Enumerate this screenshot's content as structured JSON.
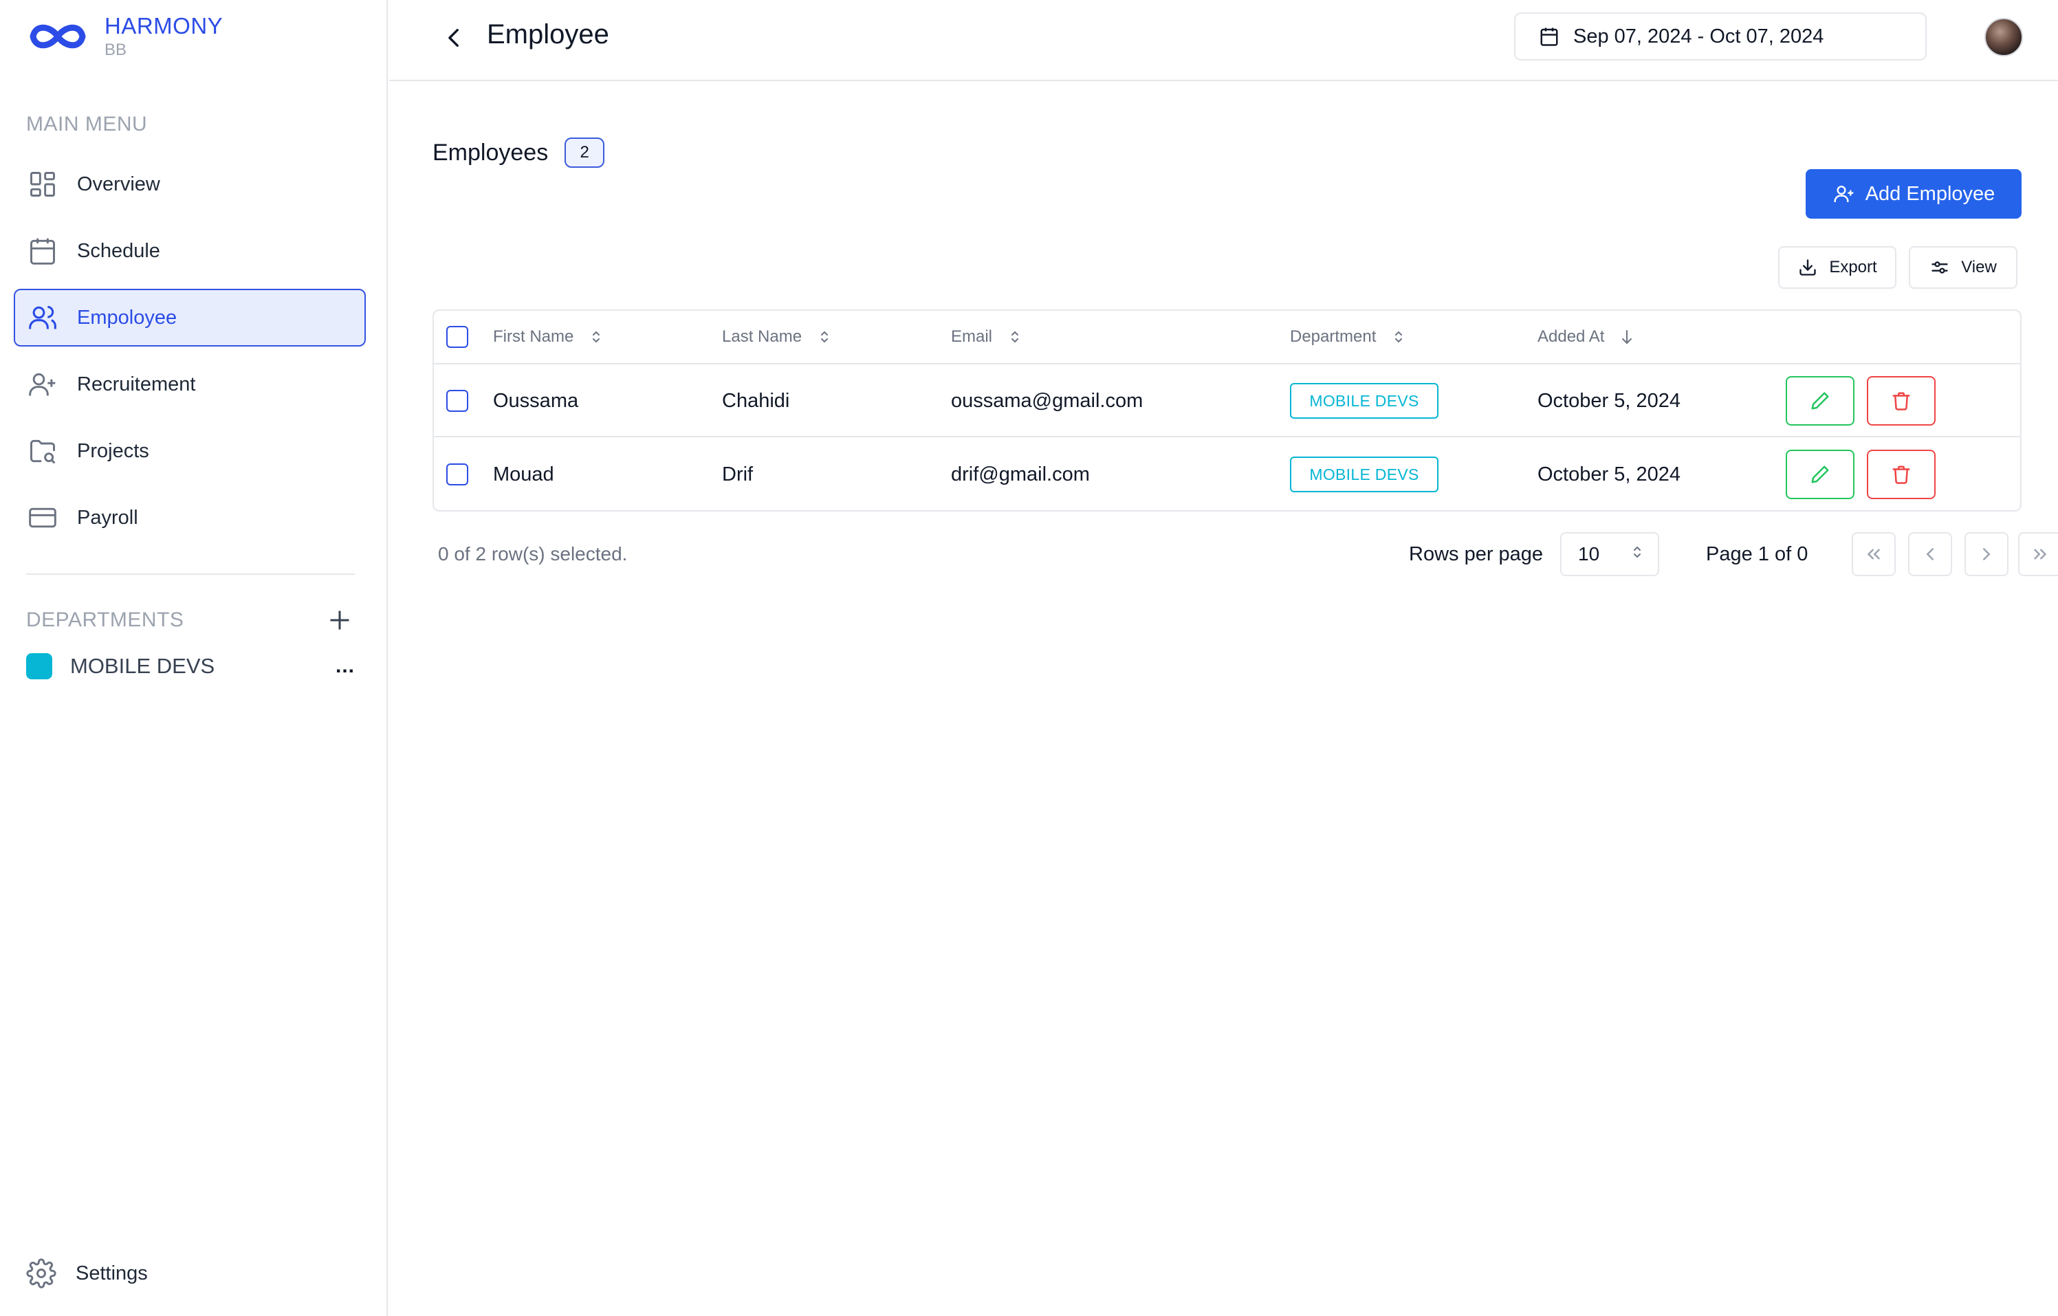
{
  "brand": {
    "name": "HARMONY",
    "subtitle": "BB"
  },
  "sidebar": {
    "main_menu_title": "MAIN MENU",
    "items": [
      {
        "label": "Overview",
        "icon": "grid-icon"
      },
      {
        "label": "Schedule",
        "icon": "calendar-icon"
      },
      {
        "label": "Empoloyee",
        "icon": "users-icon",
        "active": true
      },
      {
        "label": "Recruitement",
        "icon": "user-plus-icon"
      },
      {
        "label": "Projects",
        "icon": "folder-icon"
      },
      {
        "label": "Payroll",
        "icon": "credit-card-icon"
      }
    ],
    "departments_title": "DEPARTMENTS",
    "departments": [
      {
        "label": "MOBILE DEVS",
        "color": "#06b6d4",
        "more": "..."
      }
    ],
    "settings_label": "Settings"
  },
  "header": {
    "title": "Employee",
    "date_range": "Sep 07, 2024 - Oct 07, 2024"
  },
  "main": {
    "heading": "Employees",
    "count": "2",
    "add_button": "Add Employee",
    "export_button": "Export",
    "view_button": "View",
    "table": {
      "columns": [
        "First Name",
        "Last Name",
        "Email",
        "Department",
        "Added At"
      ],
      "rows": [
        {
          "first": "Oussama",
          "last": "Chahidi",
          "email": "oussama@gmail.com",
          "department": "MOBILE DEVS",
          "added": "October 5, 2024"
        },
        {
          "first": "Mouad",
          "last": "Drif",
          "email": "drif@gmail.com",
          "department": "MOBILE DEVS",
          "added": "October 5, 2024"
        }
      ]
    },
    "footer": {
      "selected_text": "0 of 2 row(s) selected.",
      "rows_per_page_label": "Rows per page",
      "rows_per_page_value": "10",
      "page_label": "Page 1 of 0"
    }
  },
  "colors": {
    "accent": "#2563eb",
    "brand": "#2b4ce6",
    "department": "#06b6d4",
    "edit": "#22c55e",
    "delete": "#ef4444"
  }
}
